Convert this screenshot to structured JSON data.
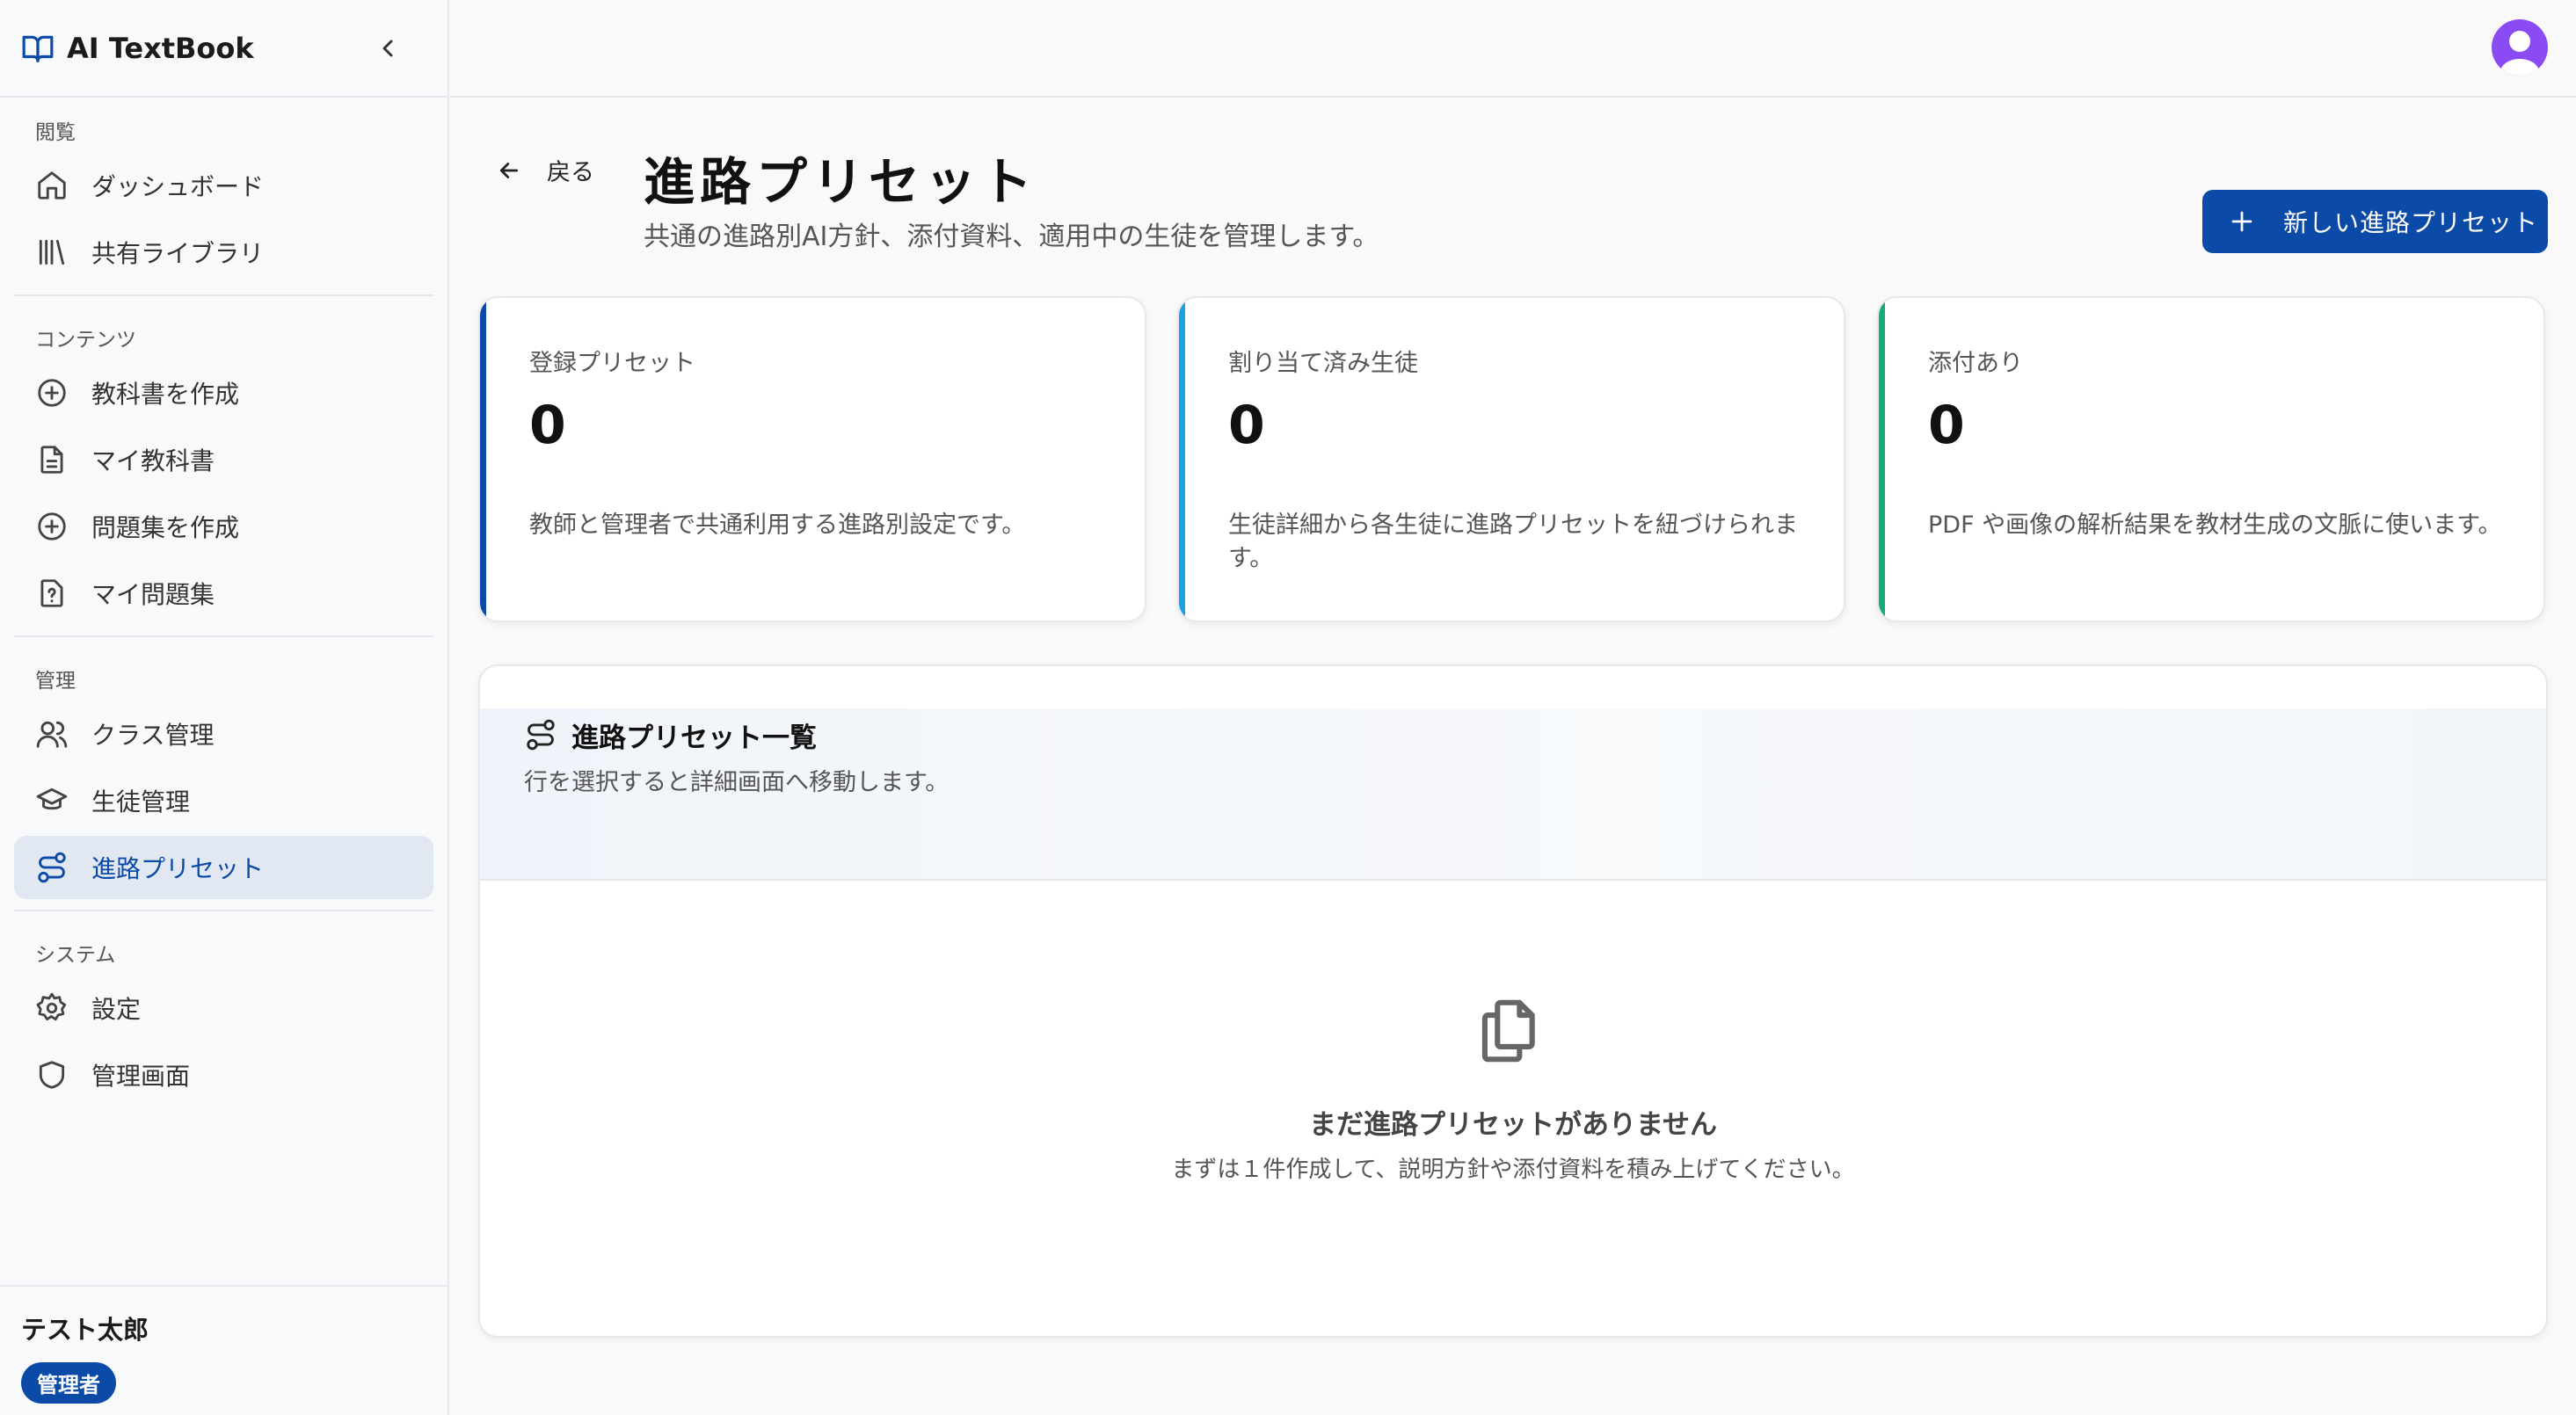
{
  "app": {
    "title": "AI TextBook"
  },
  "sidebar": {
    "sections": [
      {
        "label": "閲覧",
        "items": [
          {
            "label": "ダッシュボード"
          },
          {
            "label": "共有ライブラリ"
          }
        ]
      },
      {
        "label": "コンテンツ",
        "items": [
          {
            "label": "教科書を作成"
          },
          {
            "label": "マイ教科書"
          },
          {
            "label": "問題集を作成"
          },
          {
            "label": "マイ問題集"
          }
        ]
      },
      {
        "label": "管理",
        "items": [
          {
            "label": "クラス管理"
          },
          {
            "label": "生徒管理"
          },
          {
            "label": "進路プリセット",
            "active": true
          }
        ]
      },
      {
        "label": "システム",
        "items": [
          {
            "label": "設定"
          },
          {
            "label": "管理画面"
          }
        ]
      }
    ],
    "user": {
      "name": "テスト太郎",
      "role": "管理者"
    }
  },
  "header": {
    "back_label": "戻る",
    "title": "進路プリセット",
    "subtitle": "共通の進路別AI方針、添付資料、適用中の生徒を管理します。",
    "new_button_label": "新しい進路プリセット"
  },
  "stats": [
    {
      "label": "登録プリセット",
      "value": "0",
      "description": "教師と管理者で共通利用する進路別設定です。",
      "accent": "#0c4aa7"
    },
    {
      "label": "割り当て済み生徒",
      "value": "0",
      "description": "生徒詳細から各生徒に進路プリセットを紐づけられます。",
      "accent": "#1aa3e0"
    },
    {
      "label": "添付あり",
      "value": "0",
      "description": "PDF や画像の解析結果を教材生成の文脈に使います。",
      "accent": "#18a979"
    }
  ],
  "list": {
    "title": "進路プリセット一覧",
    "subtitle": "行を選択すると詳細画面へ移動します。",
    "empty_title": "まだ進路プリセットがありません",
    "empty_subtitle": "まずは１件作成して、説明方針や添付資料を積み上げてください。"
  },
  "colors": {
    "primary": "#0c4aa7",
    "active_bg": "#e1e8f2",
    "avatar": "#8a4bf2"
  }
}
